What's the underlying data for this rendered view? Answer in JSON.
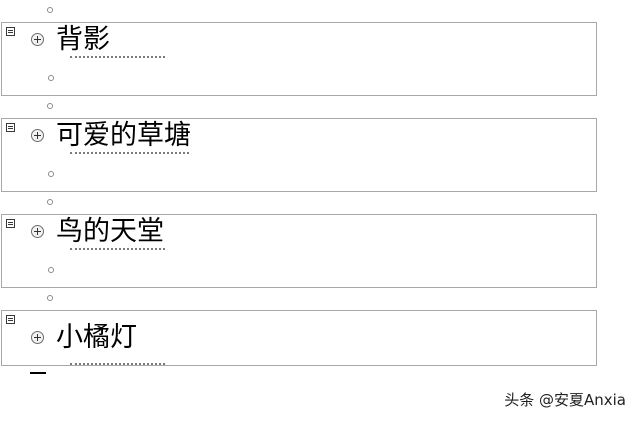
{
  "document": {
    "headings": [
      {
        "text": "背影"
      },
      {
        "text": "可爱的草塘"
      },
      {
        "text": "鸟的天堂"
      },
      {
        "text": "小橘灯"
      }
    ]
  },
  "watermark": {
    "text": "头条 @安夏Anxia"
  },
  "icons": {
    "block_handle": "outline-block-icon",
    "expand": "expand-plus-icon",
    "bullet": "hollow-circle-bullet-icon"
  },
  "colors": {
    "block_border": "#a8a8a8",
    "bullet_border": "#8a8a8a",
    "text": "#000000"
  }
}
